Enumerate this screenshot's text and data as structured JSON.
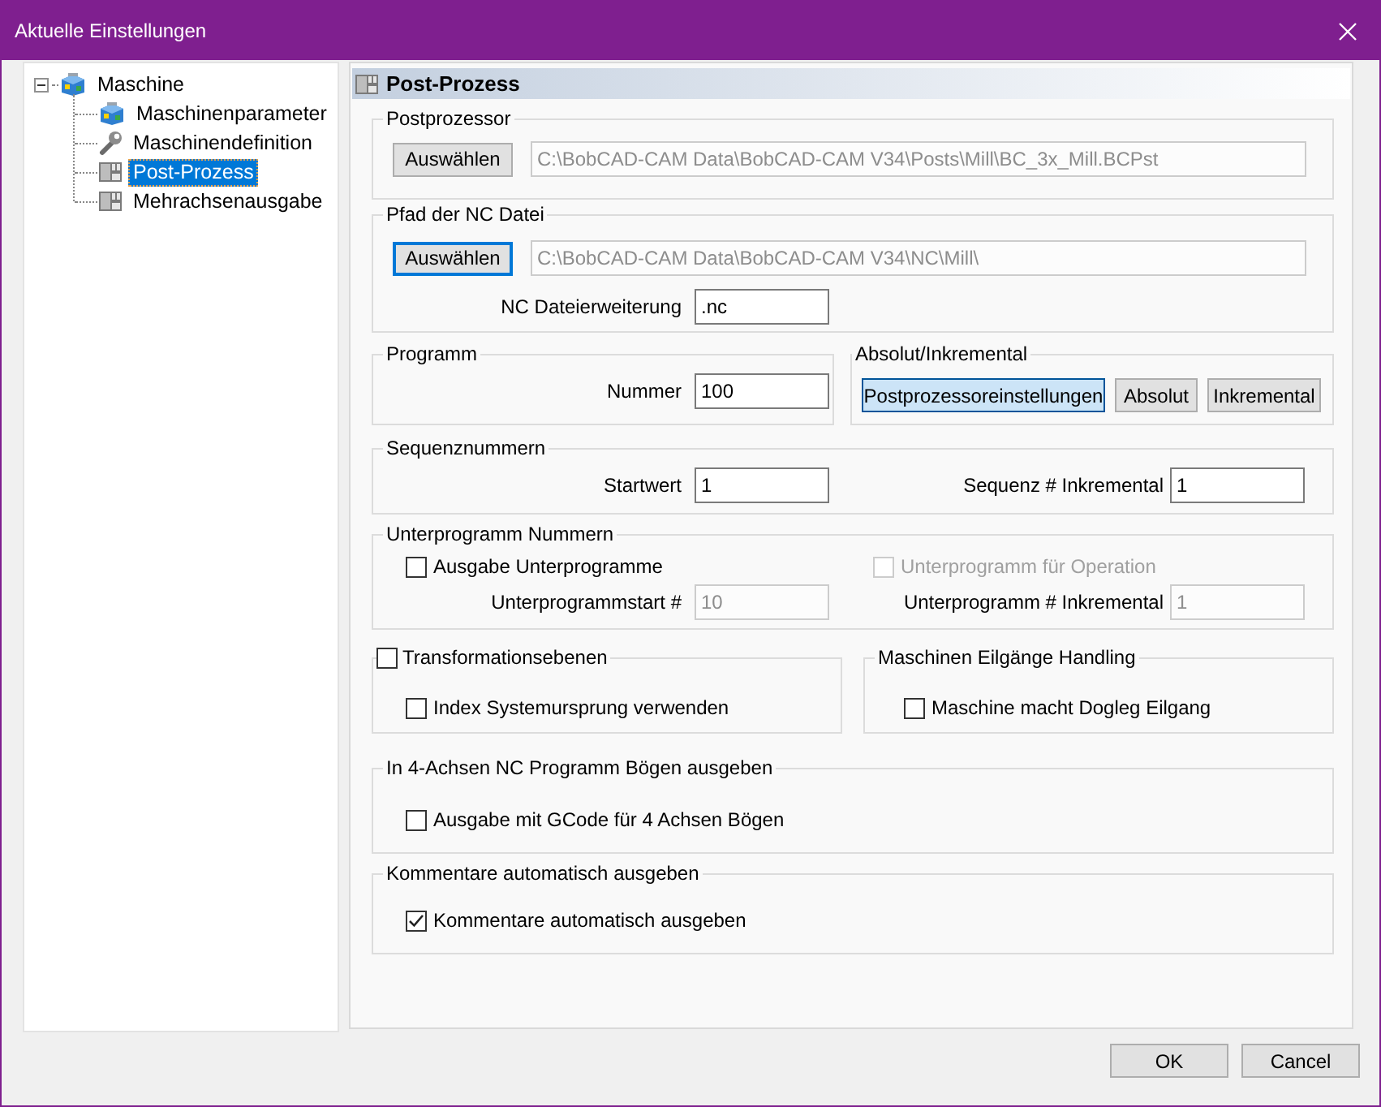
{
  "window": {
    "title": "Aktuelle Einstellungen"
  },
  "tree": {
    "label": "Maschine",
    "kind": "machine",
    "expanded": true,
    "selected": false,
    "children": [
      {
        "label": "Maschinenparameter",
        "kind": "machine",
        "selected": false
      },
      {
        "label": "Maschinendefinition",
        "kind": "wrench",
        "selected": false
      },
      {
        "label": "Post-Prozess",
        "kind": "panel",
        "selected": true
      },
      {
        "label": "Mehrachsenausgabe",
        "kind": "panel",
        "selected": false
      }
    ]
  },
  "panel": {
    "title": "Post-Prozess"
  },
  "postprocessor": {
    "legend": "Postprozessor",
    "button": {
      "label": "Auswählen",
      "focused": false
    },
    "path": {
      "value": "C:\\BobCAD-CAM Data\\BobCAD-CAM V34\\Posts\\Mill\\BC_3x_Mill.BCPst",
      "disabled": true
    }
  },
  "nc_path": {
    "legend": "Pfad der NC Datei",
    "button": {
      "label": "Auswählen",
      "focused": true
    },
    "path": {
      "value": "C:\\BobCAD-CAM Data\\BobCAD-CAM V34\\NC\\Mill\\",
      "disabled": true
    },
    "extension": {
      "label": "NC Dateierweiterung",
      "value": ".nc",
      "disabled": false
    }
  },
  "program": {
    "legend": "Programm",
    "number": {
      "label": "Nummer",
      "value": "100",
      "disabled": false
    }
  },
  "mode": {
    "legend": "Absolut/Inkremental",
    "buttons": [
      {
        "label": "Postprozessoreinstellungen",
        "selected": true
      },
      {
        "label": "Absolut",
        "selected": false
      },
      {
        "label": "Inkremental",
        "selected": false
      }
    ]
  },
  "sequence": {
    "legend": "Sequenznummern",
    "fields": [
      {
        "label": "Startwert",
        "value": "1",
        "disabled": false
      },
      {
        "label": "Sequenz # Inkremental",
        "value": "1",
        "disabled": false
      }
    ]
  },
  "subprogram": {
    "legend": "Unterprogramm Nummern",
    "checkboxes": [
      {
        "label": "Ausgabe Unterprogramme",
        "checked": false,
        "disabled": false
      },
      {
        "label": "Unterprogramm für Operation",
        "checked": false,
        "disabled": true
      }
    ],
    "fields": [
      {
        "label": "Unterprogrammstart #",
        "value": "10",
        "disabled": true
      },
      {
        "label": "Unterprogramm # Inkremental",
        "value": "1",
        "disabled": true
      }
    ]
  },
  "transform": {
    "legend": {
      "label": "Transformationsebenen",
      "checked": false
    },
    "checkbox": {
      "label": "Index Systemursprung verwenden",
      "checked": false
    }
  },
  "rapid": {
    "legend": "Maschinen Eilgänge Handling",
    "checkbox": {
      "label": "Maschine macht Dogleg Eilgang",
      "checked": false
    }
  },
  "arcs": {
    "legend": "In 4-Achsen NC Programm Bögen ausgeben",
    "checkbox": {
      "label": "Ausgabe mit GCode für 4 Achsen Bögen",
      "checked": false
    }
  },
  "comments": {
    "legend": "Kommentare automatisch ausgeben",
    "checkbox": {
      "label": "Kommentare automatisch ausgeben",
      "checked": true
    }
  },
  "buttons": [
    {
      "label": "OK"
    },
    {
      "label": "Cancel"
    }
  ]
}
